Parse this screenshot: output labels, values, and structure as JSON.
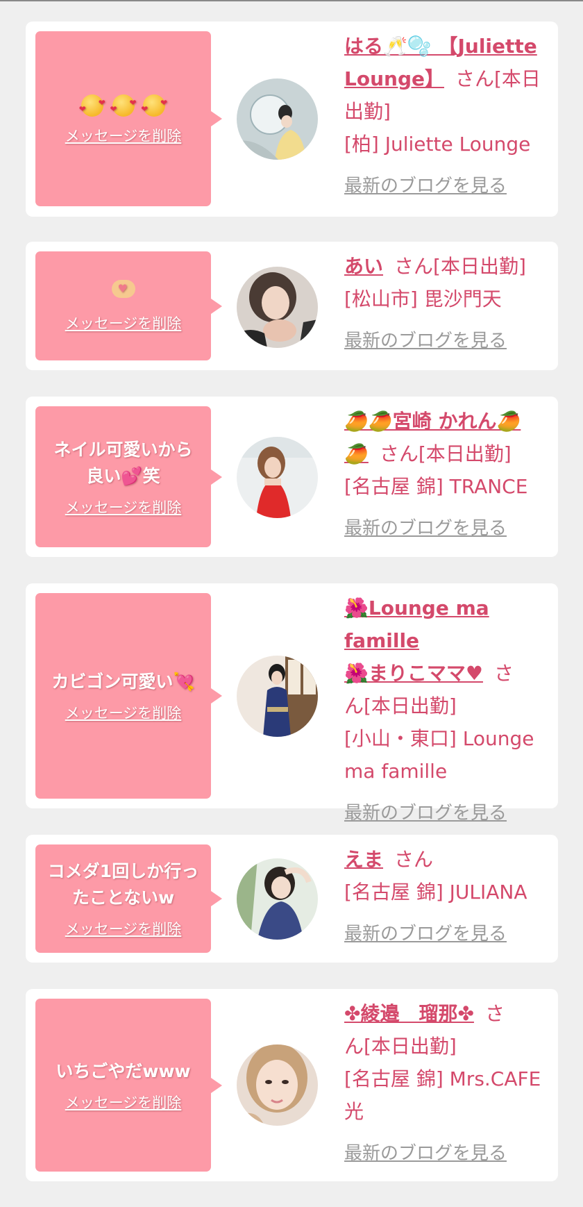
{
  "delete_label": "メッセージを削除",
  "blog_label": "最新のブログを見る",
  "san_suffix": "さん[本日出勤]",
  "san_plain": "さん",
  "cards": [
    {
      "message_icons": "emoji-smiling-face-with-hearts x3",
      "name": "はる🥂🫧【Juliette Lounge】",
      "name_line1": "はる🥂🫧 【Juliette",
      "name_line2": "Lounge】",
      "suffix": "さん[本日出勤]",
      "area_shop": "[柏] Juliette Lounge"
    },
    {
      "message_icons": "emoji-heart-hands",
      "name": "あい",
      "suffix": "さん[本日出勤]",
      "area_shop": "[松山市] 毘沙門天"
    },
    {
      "message_line1": "ネイル可愛いから",
      "message_line2a": "良い",
      "message_line2b": "笑",
      "name_line1": "🥭🥭宮崎 かれん🥭",
      "name_line2": "🥭",
      "suffix": "さん[本日出勤]",
      "area_shop": "[名古屋 錦] TRANCE"
    },
    {
      "message_line1": "カビゴン可愛い",
      "name_line1": "🌺Lounge ma famille",
      "name_line2": "🌺まりこママ♥",
      "suffix_a": "さ",
      "suffix_b": "ん[本日出勤]",
      "area_line1": "[小山・東口] Lounge",
      "area_line2": "ma famille"
    },
    {
      "message_line1": "コメダ1回しか行っ",
      "message_line2": "たことないw",
      "name": "えま",
      "suffix": "さん",
      "area_shop": "[名古屋 錦] JULIANA"
    },
    {
      "message_line1": "いちごやだwww",
      "name": "✤綾邉　瑠那✤",
      "suffix_a": "さ",
      "suffix_b": "ん[本日出勤]",
      "area_line1": "[名古屋 錦] Mrs.CAFE",
      "area_line2": "光"
    }
  ]
}
